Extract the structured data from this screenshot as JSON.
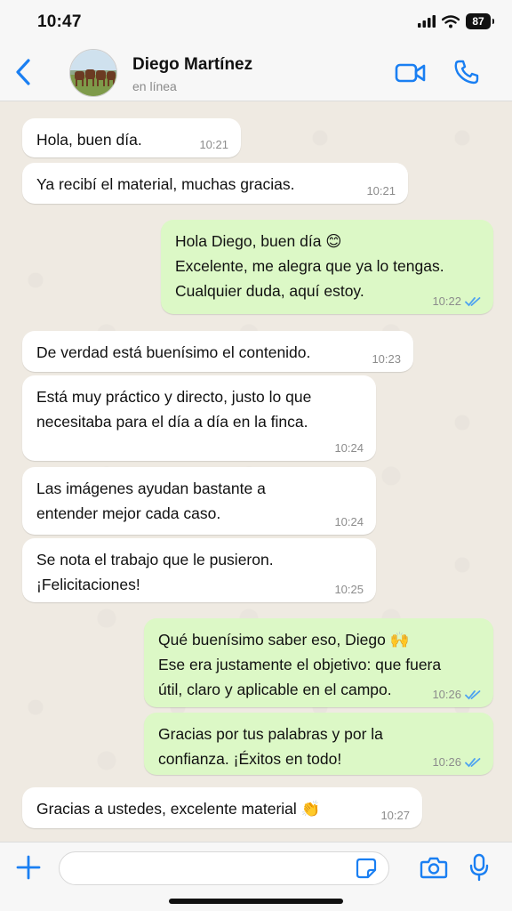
{
  "status_bar": {
    "time": "10:47",
    "battery": "87"
  },
  "header": {
    "name": "Diego Martínez",
    "status": "en línea"
  },
  "messages": [
    {
      "dir": "in",
      "lines": [
        "Hola, buen día."
      ],
      "time": "10:21"
    },
    {
      "dir": "in",
      "lines": [
        "Ya recibí el material, muchas gracias."
      ],
      "time": "10:21"
    },
    {
      "dir": "out",
      "lines": [
        "Hola Diego, buen día 😊",
        "Excelente, me alegra que ya lo tengas.",
        "Cualquier duda, aquí estoy."
      ],
      "time": "10:22",
      "read": true
    },
    {
      "dir": "in",
      "lines": [
        "De verdad está buenísimo el contenido."
      ],
      "time": "10:23"
    },
    {
      "dir": "in",
      "lines": [
        "Está muy práctico y directo, justo lo que",
        "necesitaba para el día a día en la finca."
      ],
      "time": "10:24"
    },
    {
      "dir": "in",
      "lines": [
        "Las imágenes ayudan bastante a",
        "entender mejor cada caso."
      ],
      "time": "10:24"
    },
    {
      "dir": "in",
      "lines": [
        "Se nota el trabajo que le pusieron.",
        "¡Felicitaciones!"
      ],
      "time": "10:25"
    },
    {
      "dir": "out",
      "lines": [
        "Qué buenísimo saber eso, Diego 🙌",
        "Ese era justamente el objetivo: que fuera",
        "útil, claro y aplicable en el campo."
      ],
      "time": "10:26",
      "read": true
    },
    {
      "dir": "out",
      "lines": [
        "Gracias por tus palabras y por la",
        "confianza. ¡Éxitos en todo!"
      ],
      "time": "10:26",
      "read": true
    },
    {
      "dir": "in",
      "lines": [
        "Gracias a ustedes, excelente material 👏"
      ],
      "time": "10:27"
    }
  ],
  "input": {
    "value": "",
    "placeholder": ""
  },
  "colors": {
    "accent": "#1a7ff2",
    "outgoing_bubble": "#dcf8c6",
    "incoming_bubble": "#ffffff",
    "chat_background": "#efeae2",
    "read_ticks": "#4fa3f0"
  },
  "icons": {
    "back": "chevron-left-icon",
    "video": "video-camera-icon",
    "call": "phone-icon",
    "add": "plus-icon",
    "sticker": "sticker-icon",
    "camera": "camera-icon",
    "mic": "microphone-icon",
    "read": "double-check-icon"
  }
}
